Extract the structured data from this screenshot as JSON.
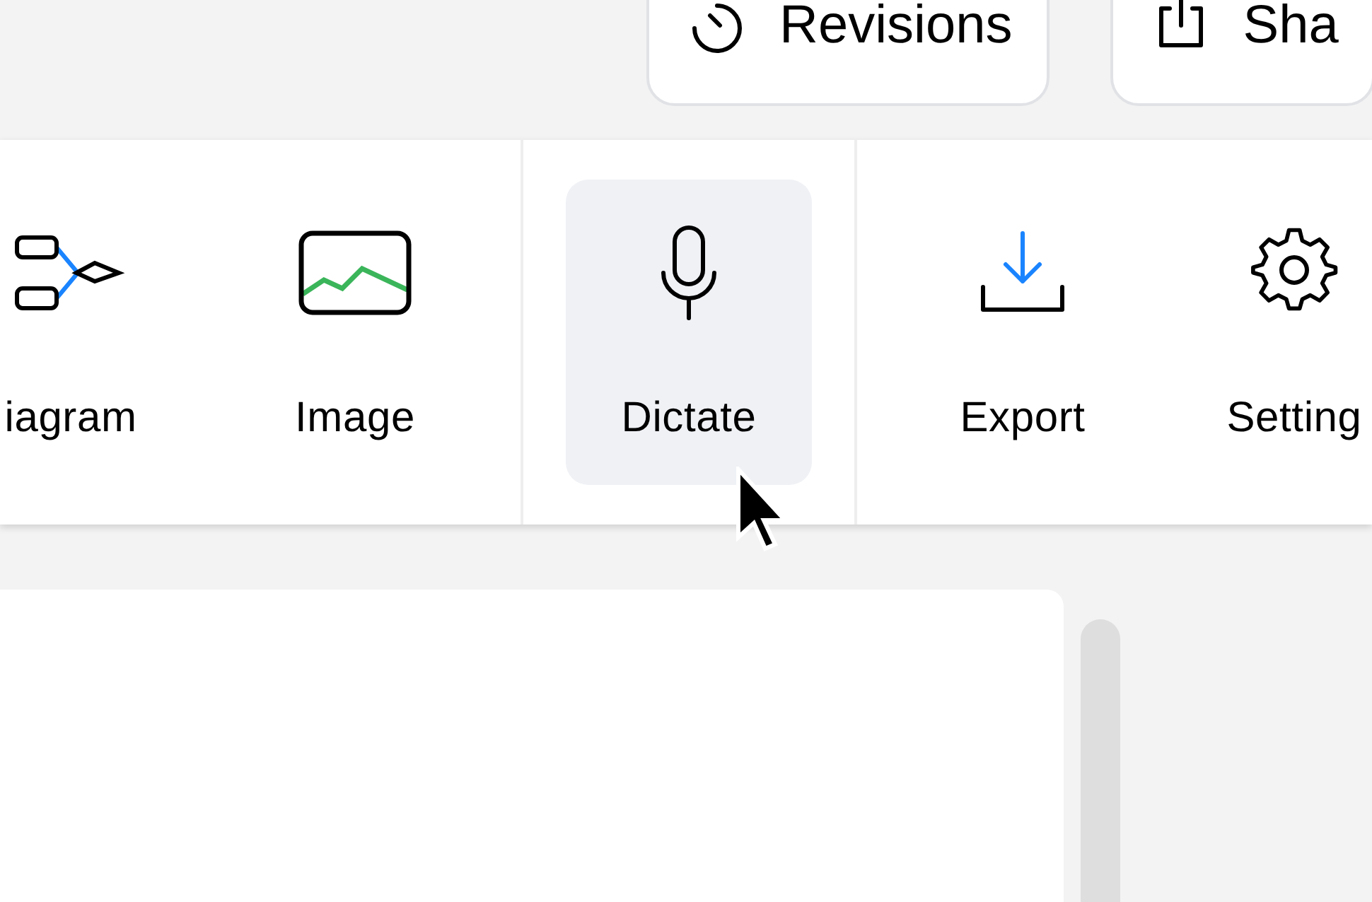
{
  "header_buttons": [
    {
      "label": "Revisions",
      "kind": "history"
    },
    {
      "label": "Sha",
      "kind": "share"
    }
  ],
  "toolbar": {
    "sections": [
      {
        "items": [
          {
            "label": "iagram",
            "kind": "diagram",
            "hovered": false
          },
          {
            "label": "Image",
            "kind": "image",
            "hovered": false
          }
        ]
      },
      {
        "items": [
          {
            "label": "Dictate",
            "kind": "mic",
            "hovered": true
          }
        ]
      },
      {
        "items": [
          {
            "label": "Export",
            "kind": "export",
            "hovered": false
          },
          {
            "label": "Setting",
            "kind": "settings",
            "hovered": false
          }
        ]
      }
    ]
  }
}
